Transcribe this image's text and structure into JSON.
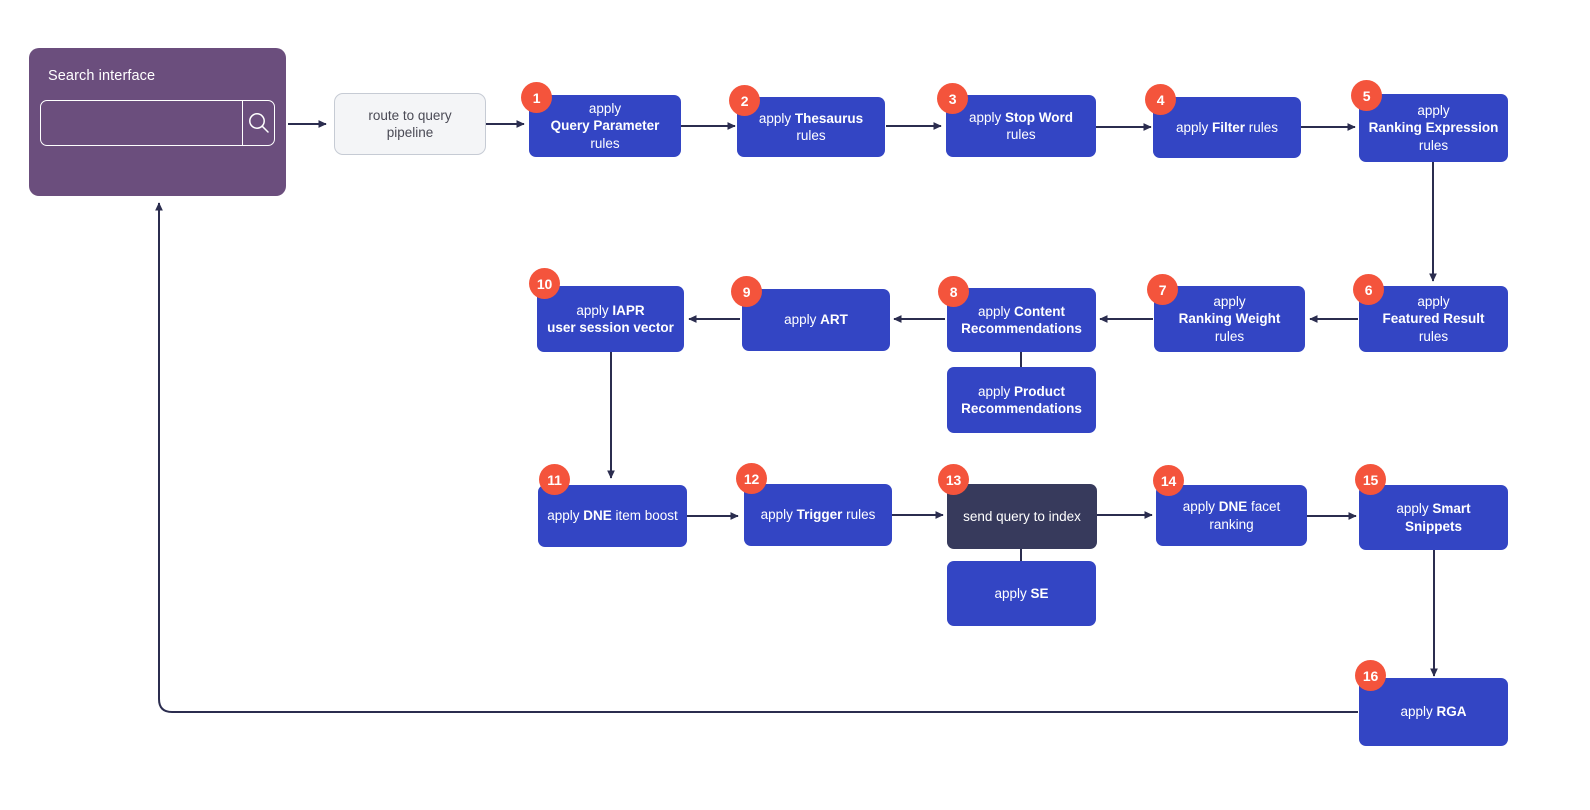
{
  "search_interface": {
    "title": "Search interface",
    "input_value": "",
    "input_placeholder": "",
    "search_icon": "magnifier-icon"
  },
  "entry_node": {
    "label": "route to query pipeline"
  },
  "nodes": [
    {
      "id": "n1",
      "badge": "1",
      "style": "blue",
      "lines": [
        {
          "t": "apply",
          "b": false
        },
        {
          "t": "Query Parameter",
          "b": true
        },
        {
          "t": "rules",
          "b": false
        }
      ]
    },
    {
      "id": "n2",
      "badge": "2",
      "style": "blue",
      "lines": [
        {
          "t": "apply ",
          "b": false,
          "t2": "Thesaurus",
          "inline": true
        },
        {
          "t": "rules",
          "b": false
        }
      ]
    },
    {
      "id": "n3",
      "badge": "3",
      "style": "blue",
      "lines": [
        {
          "t": "apply ",
          "b": false,
          "t2": "Stop Word",
          "inline": true
        },
        {
          "t": "rules",
          "b": false
        }
      ]
    },
    {
      "id": "n4",
      "badge": "4",
      "style": "blue",
      "lines": [
        {
          "t": "apply ",
          "b": false,
          "t2": "Filter",
          "t3": " rules",
          "inline": true
        }
      ]
    },
    {
      "id": "n5",
      "badge": "5",
      "style": "blue",
      "lines": [
        {
          "t": "apply",
          "b": false
        },
        {
          "t": "Ranking Expression",
          "b": true
        },
        {
          "t": "rules",
          "b": false
        }
      ]
    },
    {
      "id": "n6",
      "badge": "6",
      "style": "blue",
      "lines": [
        {
          "t": "apply",
          "b": false
        },
        {
          "t": "Featured Result",
          "b": true
        },
        {
          "t": "rules",
          "b": false
        }
      ]
    },
    {
      "id": "n7",
      "badge": "7",
      "style": "blue",
      "lines": [
        {
          "t": "apply",
          "b": false
        },
        {
          "t": "Ranking Weight",
          "b": true
        },
        {
          "t": "rules",
          "b": false
        }
      ]
    },
    {
      "id": "n8",
      "badge": "8",
      "style": "blue",
      "lines": [
        {
          "t": "apply ",
          "b": false,
          "t2": "Content",
          "inline": true
        },
        {
          "t": "Recommendations",
          "b": true
        }
      ]
    },
    {
      "id": "n9",
      "badge": "9",
      "style": "blue",
      "lines": [
        {
          "t": "apply ",
          "b": false,
          "t2": "ART",
          "inline": true
        }
      ]
    },
    {
      "id": "n10",
      "badge": "10",
      "style": "blue",
      "lines": [
        {
          "t": "apply ",
          "b": false,
          "t2": "IAPR",
          "inline": true
        },
        {
          "t": "user session vector",
          "b": true
        }
      ]
    },
    {
      "id": "n11",
      "badge": "11",
      "style": "blue",
      "lines": [
        {
          "t": "apply ",
          "b": false,
          "t2": "DNE",
          "t3": " item boost",
          "inline": true
        }
      ]
    },
    {
      "id": "n12",
      "badge": "12",
      "style": "blue",
      "lines": [
        {
          "t": "apply ",
          "b": false,
          "t2": "Trigger",
          "t3": " rules",
          "inline": true
        }
      ]
    },
    {
      "id": "n13",
      "badge": "13",
      "style": "dark",
      "lines": [
        {
          "t": "send query to index",
          "b": false
        }
      ]
    },
    {
      "id": "n14",
      "badge": "14",
      "style": "blue",
      "lines": [
        {
          "t": "apply ",
          "b": false,
          "t2": "DNE",
          "t3": " facet ranking",
          "inline": true
        }
      ]
    },
    {
      "id": "n15",
      "badge": "15",
      "style": "blue",
      "lines": [
        {
          "t": "apply ",
          "b": false,
          "t2": "Smart Snippets",
          "inline": true
        }
      ]
    },
    {
      "id": "n16",
      "badge": "16",
      "style": "blue",
      "lines": [
        {
          "t": "apply ",
          "b": false,
          "t2": "RGA",
          "inline": true
        }
      ]
    },
    {
      "id": "nProduct",
      "badge": "",
      "style": "blue",
      "lines": [
        {
          "t": "apply ",
          "b": false,
          "t2": "Product",
          "inline": true
        },
        {
          "t": "Recommendations",
          "b": true
        }
      ]
    },
    {
      "id": "nSE",
      "badge": "",
      "style": "blue",
      "lines": [
        {
          "t": "apply ",
          "b": false,
          "t2": "SE",
          "inline": true
        }
      ]
    }
  ],
  "plain_text_labels": {
    "n1_full": "apply Query Parameter rules",
    "n2_full": "apply Thesaurus rules",
    "n3_full": "apply Stop Word rules",
    "n4_full": "apply Filter rules",
    "n5_full": "apply Ranking Expression rules",
    "n6_full": "apply Featured Result rules",
    "n7_full": "apply Ranking Weight rules",
    "n8_full": "apply Content Recommendations",
    "n9_full": "apply ART",
    "n10_full": "apply IAPR user session vector",
    "n11_full": "apply DNE item boost",
    "n12_full": "apply Trigger rules",
    "n13_full": "send query to index",
    "n14_full": "apply DNE facet ranking",
    "n15_full": "apply Smart Snippets",
    "n16_full": "apply RGA",
    "product_full": "apply Product Recommendations",
    "se_full": "apply SE"
  },
  "colors": {
    "node_blue": "#3345C4",
    "node_dark": "#373A5C",
    "badge": "#F4543C",
    "search_panel": "#6B4E7D",
    "entry_node_bg": "#F4F5F7",
    "connector": "#2B2D4F"
  }
}
